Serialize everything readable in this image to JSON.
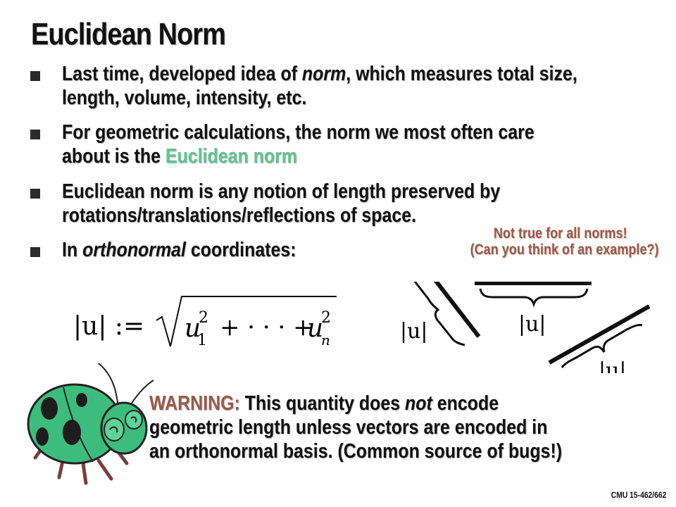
{
  "title": "Euclidean Norm",
  "bullets": [
    {
      "line1_pre": "Last time, developed idea of ",
      "line1_em": "norm",
      "line1_post": ", which measures total size,",
      "line2": "length, volume, intensity, etc."
    },
    {
      "line1": "For geometric calculations, the norm we most often care",
      "line2_pre": "about is the ",
      "line2_highlight": "Euclidean norm"
    },
    {
      "line1": "Euclidean norm is any notion of length preserved by",
      "line2": "rotations/translations/reflections of space."
    },
    {
      "pre": "In ",
      "em": "orthonormal",
      "post": " coordinates:"
    }
  ],
  "note": {
    "line1": "Not true for all norms!",
    "line2": "(Can you think of an example?)"
  },
  "formula": {
    "lhs": "|u| :=",
    "u": "u",
    "sub_first": "1",
    "sub_last": "n",
    "sup": "2",
    "ops": "+ · · · +"
  },
  "vector_label": "|u|",
  "warning": {
    "label": "WARNING:",
    "line1_pre": " This quantity does ",
    "line1_em": "not",
    "line1_post": " encode",
    "line2": "geometric length unless vectors are encoded in",
    "line3": "an orthonormal basis.  (Common source of bugs!)"
  },
  "footer": "CMU 15-462/662",
  "colors": {
    "highlight": "#5fc58f",
    "warning": "#9b5a4a",
    "bug_body": "#3dbd7d"
  }
}
